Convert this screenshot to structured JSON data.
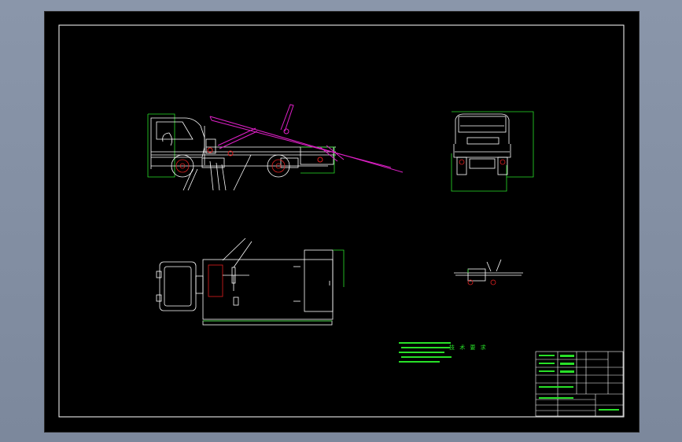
{
  "drawing": {
    "views": [
      "side-view",
      "rear-view",
      "top-view",
      "detail-view"
    ],
    "colors": {
      "background": "#000000",
      "frame": "#ffffff",
      "vehicle": "#ffffff",
      "dimension": "#28e028",
      "arm": "#e020c8",
      "wheel_hub": "#e02020",
      "outer_chrome": "#8592a6"
    },
    "notes": {
      "heading": "技 术 要 求"
    },
    "title_block": {
      "drawing_name": ""
    }
  }
}
